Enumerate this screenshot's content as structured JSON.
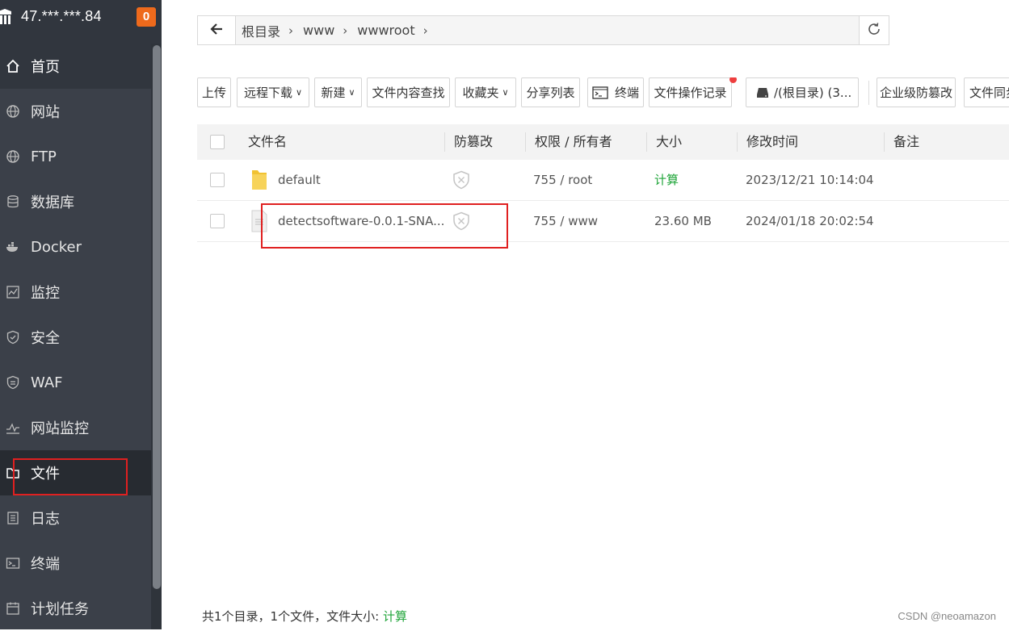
{
  "sidebar": {
    "server_ip": "47.***.***.84",
    "badge_count": "0",
    "items": [
      {
        "label": "首页",
        "icon": "home-icon"
      },
      {
        "label": "网站",
        "icon": "globe-icon"
      },
      {
        "label": "FTP",
        "icon": "globe-icon"
      },
      {
        "label": "数据库",
        "icon": "database-icon"
      },
      {
        "label": "Docker",
        "icon": "docker-icon"
      },
      {
        "label": "监控",
        "icon": "monitor-icon"
      },
      {
        "label": "安全",
        "icon": "shield-icon"
      },
      {
        "label": "WAF",
        "icon": "shield-icon"
      },
      {
        "label": "网站监控",
        "icon": "pulse-icon"
      },
      {
        "label": "文件",
        "icon": "folder-icon"
      },
      {
        "label": "日志",
        "icon": "log-icon"
      },
      {
        "label": "终端",
        "icon": "terminal-icon"
      },
      {
        "label": "计划任务",
        "icon": "calendar-icon"
      }
    ]
  },
  "pathbar": {
    "crumbs": [
      "根目录",
      "www",
      "wwwroot"
    ]
  },
  "toolbar": {
    "upload": "上传",
    "remote_download": "远程下载",
    "new": "新建",
    "content_search": "文件内容查找",
    "favorites": "收藏夹",
    "share_list": "分享列表",
    "terminal": "终端",
    "operation_log": "文件操作记录",
    "disk": "/(根目录) (3...",
    "tamper_proof": "企业级防篡改",
    "file_sync": "文件同步"
  },
  "table": {
    "headers": {
      "name": "文件名",
      "tamper": "防篡改",
      "perm_owner": "权限 / 所有者",
      "size": "大小",
      "mtime": "修改时间",
      "note": "备注"
    },
    "rows": [
      {
        "name": "default",
        "type": "folder",
        "perm": "755 / root",
        "size": "计算",
        "mtime": "2023/12/21 10:14:04"
      },
      {
        "name": "detectsoftware-0.0.1-SNA...",
        "type": "file",
        "perm": "755 / www",
        "size": "23.60 MB",
        "mtime": "2024/01/18 20:02:54"
      }
    ]
  },
  "footer": {
    "summary": "共1个目录，1个文件，文件大小:",
    "calc": "计算"
  },
  "watermark": "CSDN @neoamazon",
  "colors": {
    "sidebar_bg": "#3b4049",
    "accent_green": "#20a53a",
    "badge_orange": "#ee6a1c",
    "highlight_red": "#e02020"
  }
}
